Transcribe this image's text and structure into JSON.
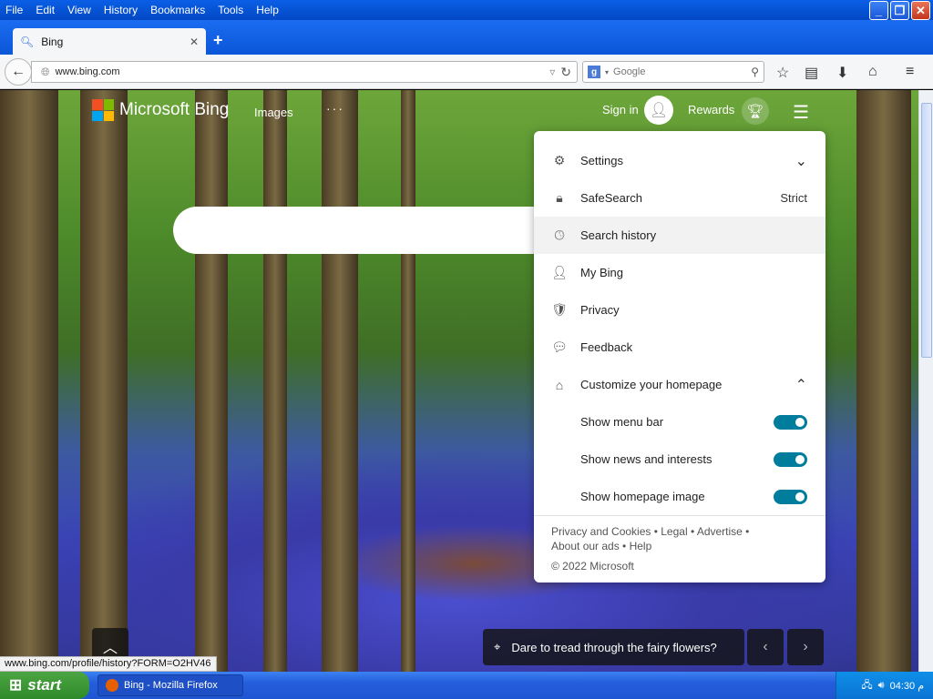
{
  "menubar": {
    "items": [
      "File",
      "Edit",
      "View",
      "History",
      "Bookmarks",
      "Tools",
      "Help"
    ]
  },
  "tab": {
    "title": "Bing"
  },
  "navbar": {
    "url": "www.bing.com",
    "search_engine": "Google",
    "search_placeholder": "Google"
  },
  "bing": {
    "logo_text": "Microsoft Bing",
    "images_link": "Images",
    "more": "···",
    "signin": "Sign in",
    "rewards": "Rewards"
  },
  "menu": {
    "items": [
      {
        "icon": "gear-icon",
        "label": "Settings",
        "right": "⌄"
      },
      {
        "icon": "lock-icon",
        "label": "SafeSearch",
        "right": "Strict"
      },
      {
        "icon": "clock-icon",
        "label": "Search history",
        "right": ""
      },
      {
        "icon": "person-star-icon",
        "label": "My Bing",
        "right": ""
      },
      {
        "icon": "shield-icon",
        "label": "Privacy",
        "right": ""
      },
      {
        "icon": "chat-icon",
        "label": "Feedback",
        "right": ""
      },
      {
        "icon": "home-icon",
        "label": "Customize your homepage",
        "right": "⌃"
      }
    ],
    "toggles": [
      {
        "label": "Show menu bar",
        "on": true
      },
      {
        "label": "Show news and interests",
        "on": true
      },
      {
        "label": "Show homepage image",
        "on": true
      }
    ],
    "footer": {
      "line1": "Privacy and Cookies • Legal • Advertise •",
      "line2": "About our ads • Help",
      "copyright": "© 2022 Microsoft"
    }
  },
  "caption": {
    "text": "Dare to tread through the fairy flowers?"
  },
  "status_url": "www.bing.com/profile/history?FORM=O2HV46",
  "taskbar": {
    "start": "start",
    "task": "Bing - Mozilla Firefox",
    "clock": "04:30 م"
  },
  "colors": {
    "toggle_on": "#007d9c",
    "xp_blue": "#0a5fe6",
    "start_green": "#2f8a2a"
  }
}
